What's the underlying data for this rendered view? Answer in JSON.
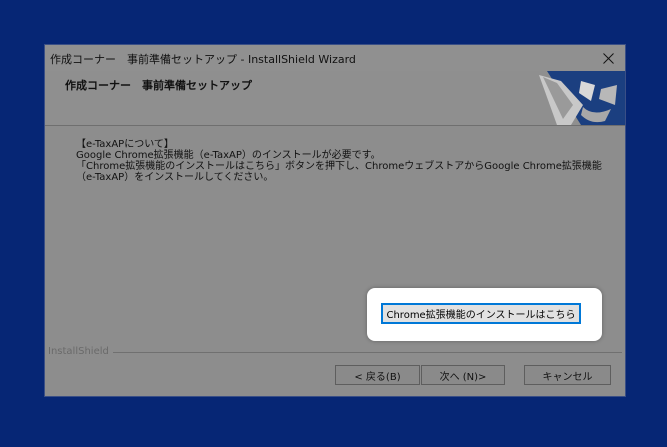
{
  "window": {
    "title": "作成コーナー　事前準備セットアップ - InstallShield Wizard"
  },
  "header": {
    "title": "作成コーナー　事前準備セットアップ"
  },
  "content": {
    "lines": [
      "【e-TaxAPについて】",
      "Google Chrome拡張機能（e-TaxAP）のインストールが必要です。",
      "「Chrome拡張機能のインストールはこちら」ボタンを押下し、ChromeウェブストアからGoogle Chrome拡張機能",
      "（e-TaxAP）をインストールしてください。"
    ]
  },
  "chrome_button": {
    "label": "Chrome拡張機能のインストールはこちら"
  },
  "footer": {
    "brand": "InstallShield",
    "back_label": "< 戻る(B)",
    "next_label": "次へ (N)>",
    "cancel_label": "キャンセル"
  },
  "colors": {
    "desktop": "#062675",
    "window": "#8d8d8d",
    "focus": "#0078d7"
  }
}
